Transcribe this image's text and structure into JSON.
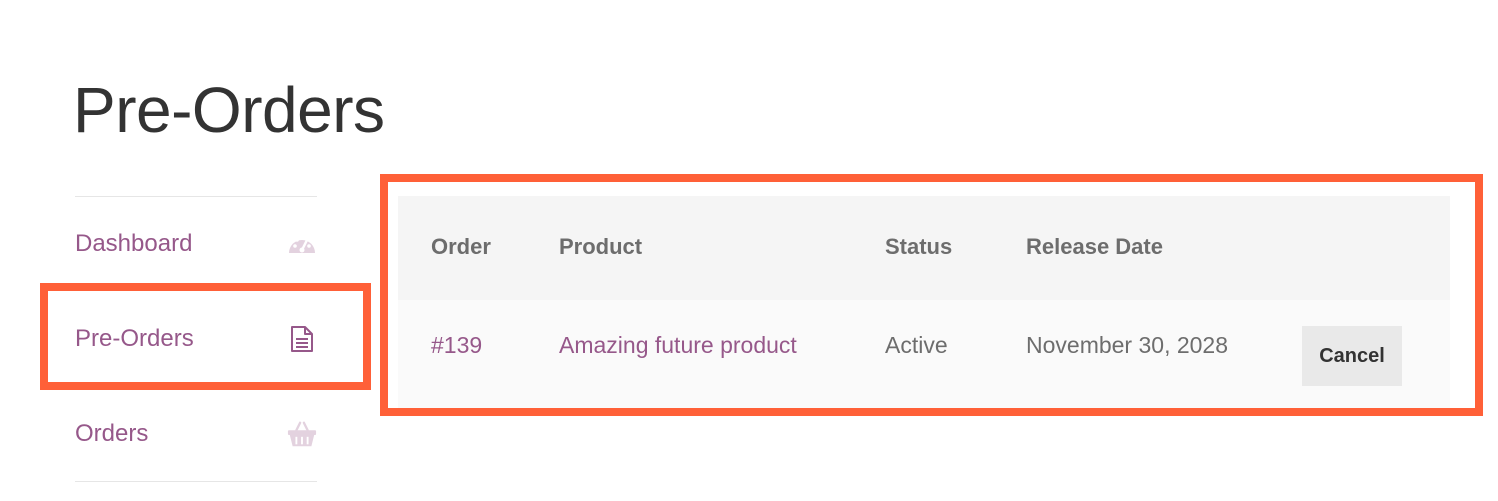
{
  "page": {
    "title": "Pre-Orders"
  },
  "sidebar": {
    "items": [
      {
        "label": "Dashboard",
        "icon": "dashboard-gauge-icon"
      },
      {
        "label": "Pre-Orders",
        "icon": "document-icon"
      },
      {
        "label": "Orders",
        "icon": "basket-icon"
      }
    ]
  },
  "table": {
    "headers": {
      "order": "Order",
      "product": "Product",
      "status": "Status",
      "release_date": "Release Date"
    },
    "rows": [
      {
        "order": "#139",
        "product": "Amazing future product",
        "status": "Active",
        "release_date": "November 30, 2028",
        "action": "Cancel"
      }
    ]
  },
  "colors": {
    "link": "#96588a",
    "highlight": "#ff6038",
    "header_bg": "#f5f5f5",
    "row_bg": "#fafafa"
  }
}
